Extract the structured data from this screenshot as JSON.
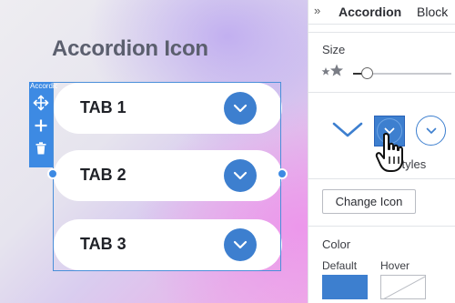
{
  "canvas": {
    "title": "Accordion Icon",
    "block_toolbar_label": "Accordion",
    "tabs": [
      {
        "label": "TAB 1"
      },
      {
        "label": "TAB 2"
      },
      {
        "label": "TAB 3"
      }
    ]
  },
  "panel": {
    "tabs": [
      "Accordion",
      "Block"
    ],
    "size_label": "Size",
    "size_value_fraction": 0.1,
    "icon_styles_label": "Icon Styles",
    "icon_styles_label_visible": "n Styles",
    "change_icon_label": "Change Icon",
    "color_label": "Color",
    "color_default_label": "Default",
    "color_hover_label": "Hover"
  },
  "colors": {
    "accent": "#3d7fcf",
    "selection": "#3d8ae3"
  }
}
